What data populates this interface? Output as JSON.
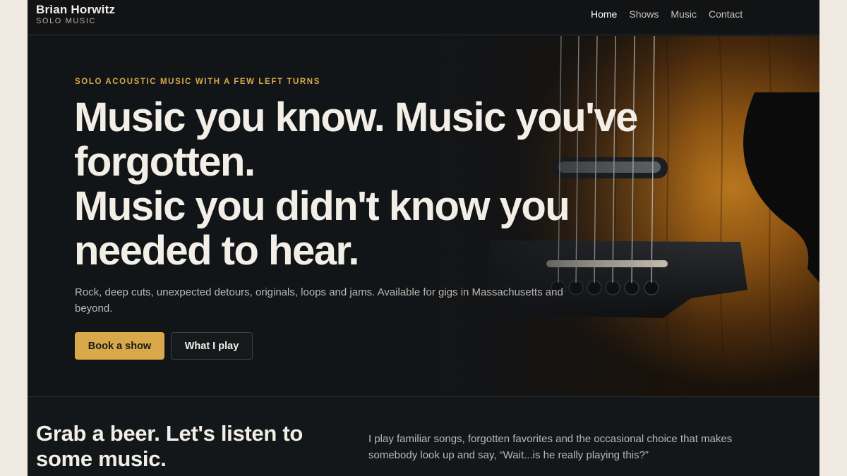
{
  "header": {
    "brand_name": "Brian Horwitz",
    "brand_subtitle": "SOLO MUSIC",
    "nav": [
      {
        "label": "Home",
        "active": true
      },
      {
        "label": "Shows",
        "active": false
      },
      {
        "label": "Music",
        "active": false
      },
      {
        "label": "Contact",
        "active": false
      }
    ]
  },
  "hero": {
    "eyebrow": "SOLO ACOUSTIC MUSIC WITH A FEW LEFT TURNS",
    "headline_line1": "Music you know. Music you've",
    "headline_line2": "forgotten.",
    "headline_line3": "Music you didn't know you",
    "headline_line4": "needed to hear.",
    "subtext": "Rock, deep cuts, unexpected detours, originals, loops and jams. Available for gigs in Massachusetts and beyond.",
    "primary_button": "Book a show",
    "secondary_button": "What I play",
    "image_icon": "acoustic-guitar-photo"
  },
  "intro": {
    "title": "Grab a beer. Let's listen to some music.",
    "body": "I play familiar songs, forgotten favorites and the occasional choice that makes somebody look up and say, “Wait...is he really playing this?”"
  },
  "colors": {
    "accent": "#d9a84a",
    "background": "#14171a",
    "text": "#f3efe7",
    "muted_text": "#bdb8af"
  }
}
